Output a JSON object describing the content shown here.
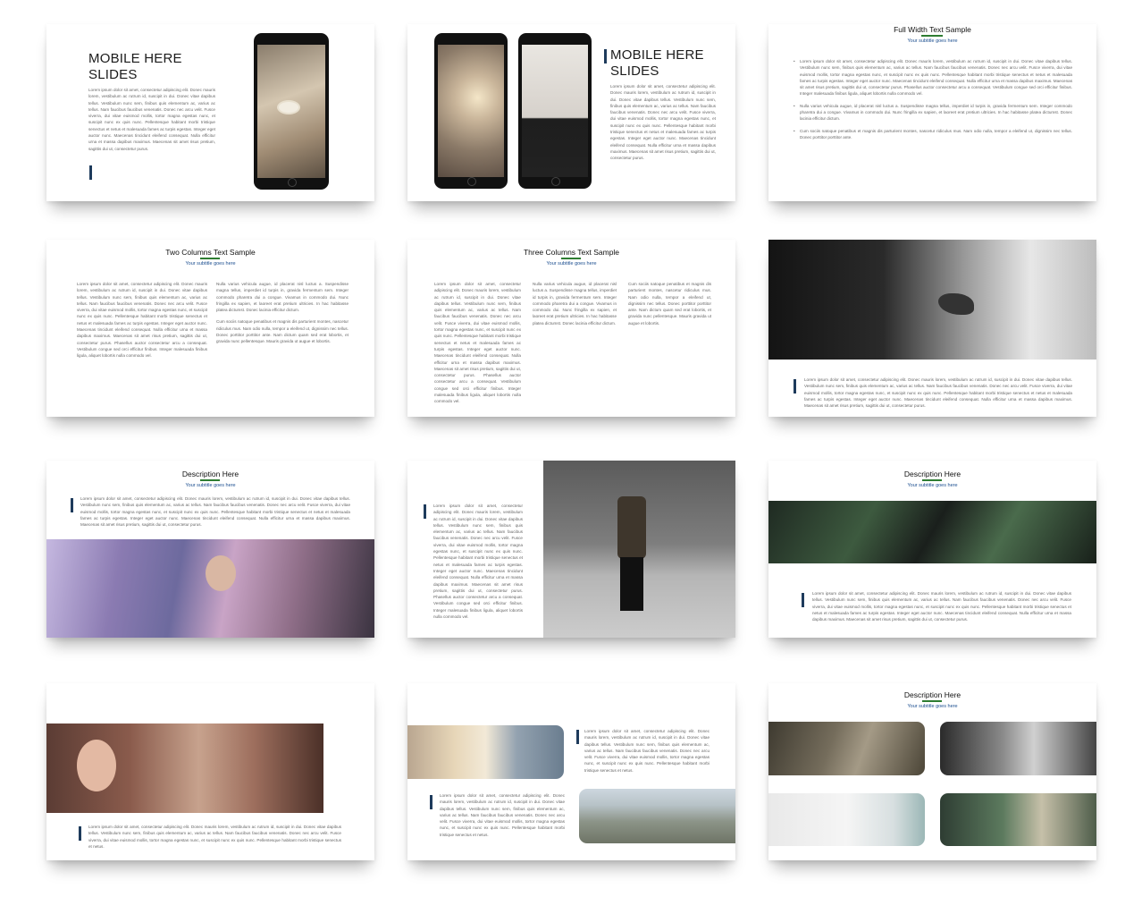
{
  "mobile": {
    "title_line1": "MOBILE HERE",
    "title_line2": "SLIDES"
  },
  "full_width": {
    "title": "Full Width Text Sample",
    "subtitle": "Your subtitle goes here"
  },
  "two_columns": {
    "title": "Two Columns Text Sample",
    "subtitle": "Your subtitle goes here"
  },
  "three_columns": {
    "title": "Three Columns Text Sample",
    "subtitle": "Your subtitle goes here"
  },
  "description": {
    "title": "Description Here",
    "subtitle": "Your subtitle goes here"
  },
  "lorem": {
    "p1": "Lorem ipsum dolor sit amet, consectetur adipiscing elit. Donec mauris lorem, vestibulum ac rutrum id, suscipit in dui. Donec vitae dapibus tellus. Vestibulum nunc sem, finibus quis elementum ac, varius ac tellus. Nam faucibus faucibus venenatis. Donec nec arcu velit. Fusce viverra, dui vitae euismod mollis, tortor magna egestas nunc, et suscipit nunc ex quis nunc. Pellentesque habitant morbi tristique senectus et netus et malesuada fames ac turpis egestas. Integer eget auctor nunc. Maecenas tincidunt eleifend consequat. Nulla efficitur urna et massa dapibus maximus. Maecenas sit amet risus pretium, sagittis dui ut, consectetur purus.",
    "p1_long": "Lorem ipsum dolor sit amet, consectetur adipiscing elit. Donec mauris lorem, vestibulum ac rutrum id, suscipit in dui. Donec vitae dapibus tellus. Vestibulum nunc sem, finibus quis elementum ac, varius ac tellus. Nam faucibus faucibus venenatis. Donec nec arcu velit. Fusce viverra, dui vitae euismod mollis, tortor magna egestas nunc, et suscipit nunc ex quis nunc. Pellentesque habitant morbi tristique senectus et netus et malesuada fames ac turpis egestas. Integer eget auctor nunc. Maecenas tincidunt eleifend consequat. Nulla efficitur urna et massa dapibus maximus. Maecenas sit amet risus pretium, sagittis dui ut, consectetur purus. Phasellus auctor consectetur arcu a consequat. Vestibulum congue sed orci efficitur finibus. Integer malesuada finibus ligula, aliquet lobortis nulla commodo vel.",
    "p2": "Nulla varius vehicula augue, id placerat nisl luctus a. Suspendisse magna tellus, imperdiet id turpis in, gravida fermentum sem. Integer commodo pharetra dui a congue. Vivamus in commodo dui. Nunc fringilla ex sapien, et laoreet erat pretium ultricies. In hac habitasse platea dictumst. Donec lacinia efficitur dictum.",
    "p3": "Cum sociis natoque penatibus et magnis dis parturient montes, nascetur ridiculus mus. Nam odio nulla, tempor a eleifend ut, dignissim nec tellus. Donec porttitor porttitor ante. Nam dictum quam sed erat lobortis, et gravida nunc pellentesque. Mauris gravida ut augue et lobortis.",
    "p3_short": "Cum sociis natoque penatibus et magnis dis parturient montes, nascetur ridiculus mus. Nam odio nulla, tempor a eleifend ut, dignissim nec tellus. Donec porttitor porttitor ante.",
    "short": "Lorem ipsum dolor sit amet, consectetur adipiscing elit. Donec mauris lorem, vestibulum ac rutrum id, suscipit in dui. Donec vitae dapibus tellus. Vestibulum nunc sem, finibus quis elementum ac, varius ac tellus. Nam faucibus faucibus venenatis. Donec nec arcu velit. Fusce viverra, dui vitae euismod mollis, tortor magna egestas nunc, et suscipit nunc ex quis nunc. Pellentesque habitant morbi tristique senectus et netus."
  },
  "colors": {
    "accent_bar": "#1e3b5c",
    "underline": "#2e7d32",
    "subtitle": "#1a4d8f"
  }
}
